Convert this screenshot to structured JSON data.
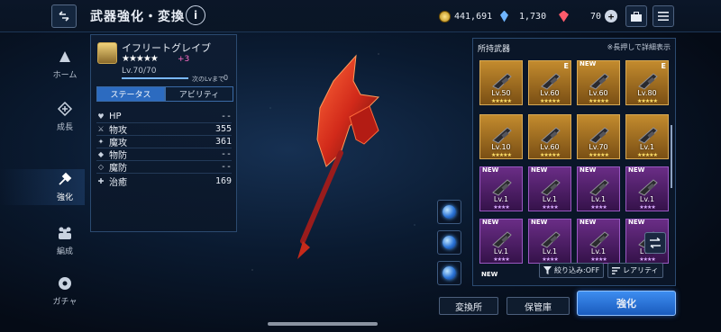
{
  "header": {
    "title": "武器強化・変換",
    "info_icon": "i",
    "gil": "441,691",
    "crystals": "1,730",
    "gems": "70",
    "plus_label": "+",
    "icons": [
      "back-arrows-icon",
      "info-icon",
      "coin-icon",
      "crystal-icon",
      "gem-icon",
      "briefcase-icon",
      "menu-icon"
    ]
  },
  "nav": {
    "items": [
      {
        "label": "ホーム",
        "icon": "home-icon"
      },
      {
        "label": "成長",
        "icon": "growth-icon"
      },
      {
        "label": "強化",
        "icon": "enhance-icon",
        "active": true
      },
      {
        "label": "編成",
        "icon": "party-icon"
      },
      {
        "label": "ガチャ",
        "icon": "gacha-icon"
      }
    ]
  },
  "weapon": {
    "name": "イフリートグレイブ",
    "stars": "★★★★★",
    "plus": "+3",
    "level": "Lv.70/70",
    "next_label": "次のLvまで",
    "next_value": "0",
    "exp_fill_fraction": 1.0,
    "tabs": [
      "ステータス",
      "アビリティ"
    ],
    "stats": [
      {
        "icon": "heart",
        "label": "HP",
        "value": "--"
      },
      {
        "icon": "sword",
        "label": "物攻",
        "value": "355"
      },
      {
        "icon": "wand",
        "label": "魔攻",
        "value": "361"
      },
      {
        "icon": "shield",
        "label": "物防",
        "value": "--"
      },
      {
        "icon": "shield-magic",
        "label": "魔防",
        "value": "--"
      },
      {
        "icon": "heal",
        "label": "治癒",
        "value": "169"
      }
    ]
  },
  "inventory": {
    "title": "所持武器",
    "hint": "※長押しで詳細表示",
    "rows": [
      [
        {
          "style": "gold",
          "level": "Lv.50",
          "stars": "★★★★★"
        },
        {
          "style": "gold",
          "level": "Lv.60",
          "stars": "★★★★★",
          "badge_e": "E"
        },
        {
          "style": "gold",
          "level": "Lv.60",
          "stars": "★★★★★",
          "new": "NEW"
        },
        {
          "style": "gold",
          "level": "Lv.80",
          "stars": "★★★★★",
          "badge_e": "E"
        }
      ],
      [
        {
          "style": "gold",
          "level": "Lv.10",
          "stars": "★★★★★"
        },
        {
          "style": "gold",
          "level": "Lv.60",
          "stars": "★★★★★"
        },
        {
          "style": "gold",
          "level": "Lv.70",
          "stars": "★★★★★"
        },
        {
          "style": "gold",
          "level": "Lv.1",
          "stars": "★★★★★"
        }
      ],
      [
        {
          "style": "purple",
          "level": "Lv.1",
          "stars": "★★★★",
          "new": "NEW"
        },
        {
          "style": "purple",
          "level": "Lv.1",
          "stars": "★★★★",
          "new": "NEW"
        },
        {
          "style": "purple",
          "level": "Lv.1",
          "stars": "★★★★",
          "new": "NEW"
        },
        {
          "style": "purple",
          "level": "Lv.1",
          "stars": "★★★★",
          "new": "NEW"
        }
      ],
      [
        {
          "style": "purple",
          "level": "Lv.1",
          "stars": "★★★★",
          "new": "NEW"
        },
        {
          "style": "purple",
          "level": "Lv.1",
          "stars": "★★★★",
          "new": "NEW"
        },
        {
          "style": "purple",
          "level": "Lv.1",
          "stars": "★★★★",
          "new": "NEW"
        },
        {
          "style": "purple",
          "level": "Lv.1",
          "stars": "★★★★",
          "new": "NEW"
        }
      ]
    ],
    "partial_new": "NEW",
    "filter_label": "絞り込み:OFF",
    "sort_label": "レアリティ"
  },
  "actions": {
    "exchange": "変換所",
    "storage": "保管庫",
    "enhance": "強化"
  }
}
